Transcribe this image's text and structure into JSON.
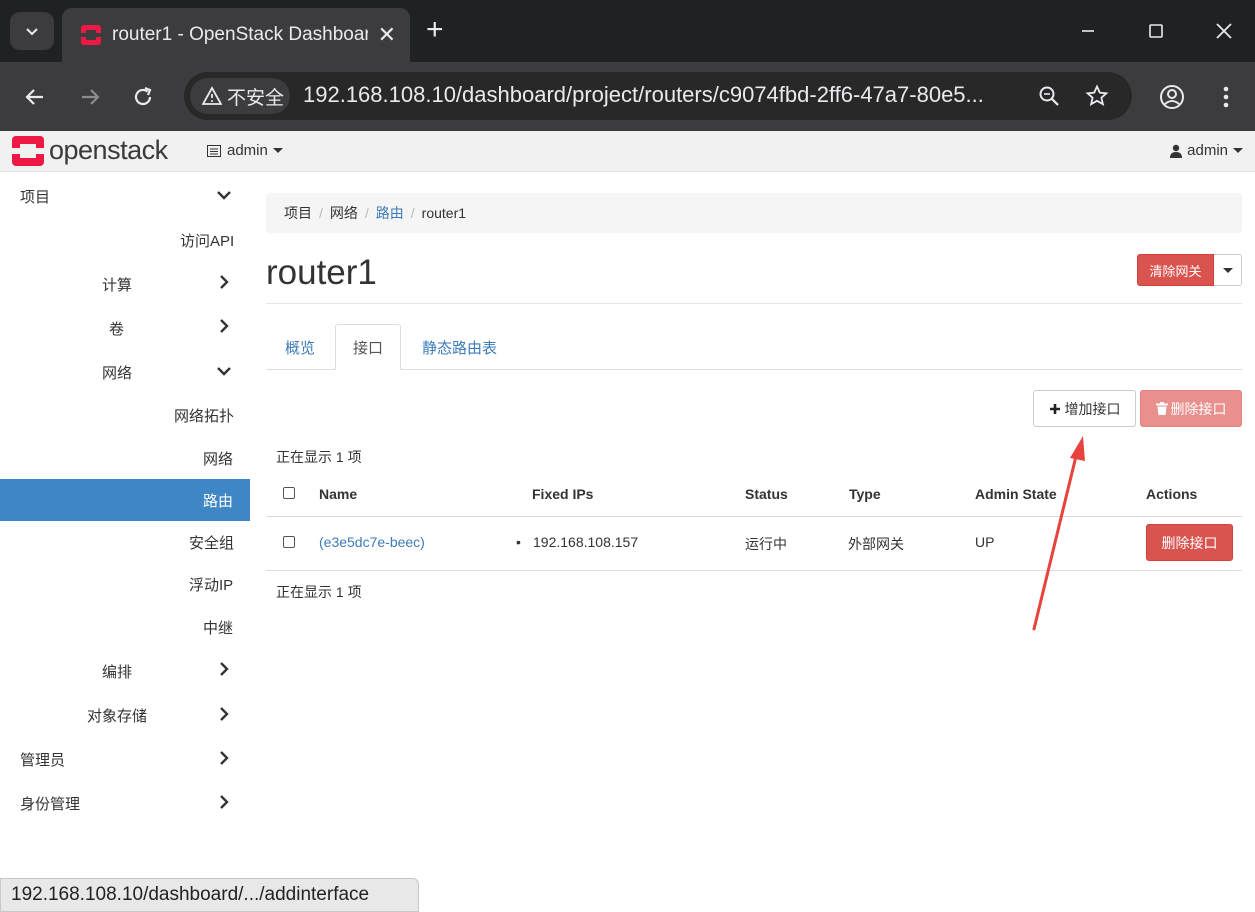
{
  "browser": {
    "tab_title": "router1 - OpenStack Dashboard",
    "security_label": "不安全",
    "url": "192.168.108.10/dashboard/project/routers/c9074fbd-2ff6-47a7-80e5...",
    "status_url": "192.168.108.10/dashboard/.../addinterface"
  },
  "header": {
    "logo_text": "openstack",
    "project": "admin",
    "user": "admin"
  },
  "sidebar": {
    "project": "项目",
    "api_access": "访问API",
    "compute": "计算",
    "volumes": "卷",
    "network": "网络",
    "network_topology": "网络拓扑",
    "networks": "网络",
    "routers": "路由",
    "security_groups": "安全组",
    "floating_ips": "浮动IP",
    "trunks": "中继",
    "orchestration": "编排",
    "object_store": "对象存储",
    "admin": "管理员",
    "identity": "身份管理"
  },
  "breadcrumb": {
    "project": "项目",
    "network": "网络",
    "routers": "路由",
    "current": "router1"
  },
  "page": {
    "title": "router1",
    "clear_gateway": "清除网关"
  },
  "tabs": {
    "overview": "概览",
    "interfaces": "接口",
    "static_routes": "静态路由表"
  },
  "actions": {
    "add_interface": "增加接口",
    "delete_interfaces": "删除接口"
  },
  "table": {
    "showing_top": "正在显示 1 项",
    "showing_bottom": "正在显示 1 项",
    "headers": {
      "name": "Name",
      "fixed_ips": "Fixed IPs",
      "status": "Status",
      "type": "Type",
      "admin_state": "Admin State",
      "actions": "Actions"
    },
    "rows": [
      {
        "name": "(e3e5dc7e-beec)",
        "fixed_ip": "192.168.108.157",
        "status": "运行中",
        "type": "外部网关",
        "admin_state": "UP",
        "action": "删除接口"
      }
    ]
  },
  "colors": {
    "danger": "#d9534f",
    "primary": "#3e86c6",
    "link": "#3c7cb8",
    "annotation_arrow": "#e8423c"
  }
}
